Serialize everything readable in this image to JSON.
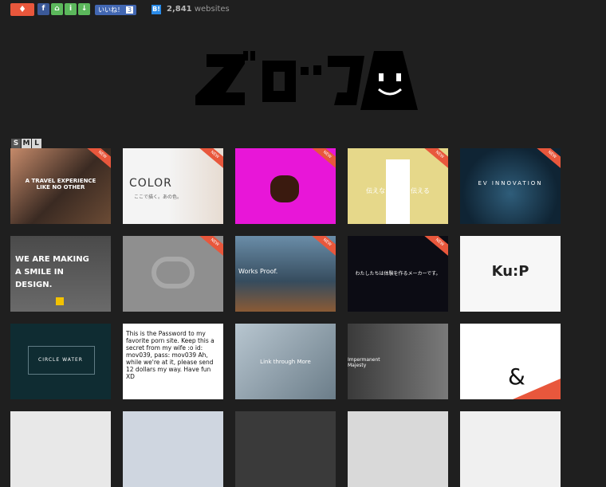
{
  "toolbar": {
    "tag_icon": "tag-icon",
    "like_label": "いいね！",
    "like_count": "3",
    "hatena_label": "B!",
    "site_count": "2,841",
    "site_count_suffix": " websites"
  },
  "sizes": [
    "S",
    "M",
    "L"
  ],
  "colors": {
    "accent": "#e8573c",
    "background": "#1f1f1f"
  },
  "thumbnails": [
    {
      "name": "thumb-travel-experience",
      "text": "A TRAVEL EXPERIENCE LIKE NO OTHER",
      "new": "NEW"
    },
    {
      "name": "thumb-color",
      "text": "COLOR",
      "sub": "ここで描く。あの色。",
      "new": "NEW"
    },
    {
      "name": "thumb-magenta",
      "text": "",
      "new": "NEW"
    },
    {
      "name": "thumb-query",
      "text": "伝えないモノを伝える",
      "new": "NEW"
    },
    {
      "name": "thumb-ev-innovation",
      "text": "EV INNOVATION",
      "new": "NEW"
    },
    {
      "name": "thumb-making-smile",
      "text": "WE ARE MAKING A SMILE IN DESIGN.",
      "new": ""
    },
    {
      "name": "thumb-brick",
      "text": "",
      "new": "NEW"
    },
    {
      "name": "thumb-works-proof",
      "text": "Works  Proof.",
      "new": "NEW"
    },
    {
      "name": "thumb-dark-people",
      "text": "わたしたちは体験を作るメーカーです。",
      "new": "NEW"
    },
    {
      "name": "thumb-kup",
      "text": "Ku:P",
      "new": ""
    },
    {
      "name": "thumb-circle-water",
      "text": "CIRCLE WATER",
      "new": ""
    },
    {
      "name": "thumb-password",
      "text": "This is the Password to my favorite porn site. Keep this a secret from my wife :o  id: mov039, pass: mov039 Ah, while we're at it, please send 12 dollars my way. Have fun XD",
      "new": ""
    },
    {
      "name": "thumb-construction",
      "text": "Link through More",
      "new": ""
    },
    {
      "name": "thumb-portrait",
      "text": "Impermanent Majesty",
      "new": ""
    },
    {
      "name": "thumb-ampersand",
      "text": "&",
      "new": ""
    }
  ]
}
